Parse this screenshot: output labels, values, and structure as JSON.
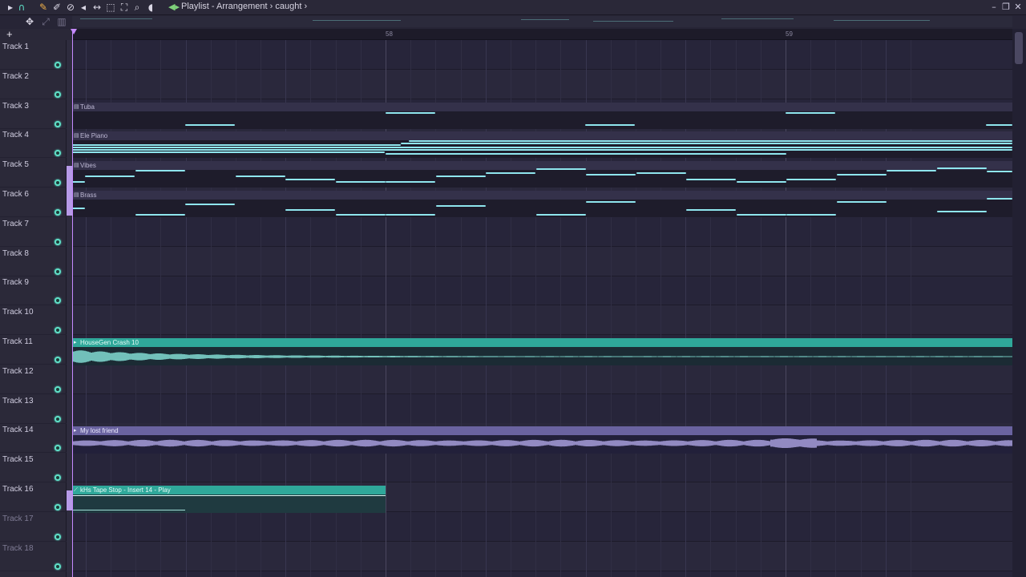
{
  "window": {
    "title": "Playlist - Arrangement",
    "crumb": "caught"
  },
  "toolbar": {
    "icons": [
      "magnet-icon",
      "pencil-icon",
      "paint-icon",
      "delete-icon",
      "mute-icon",
      "slip-icon",
      "select-icon",
      "zoom-icon",
      "magnifier-icon",
      "playback-icon"
    ]
  },
  "ruler": {
    "bars": [
      "58",
      "59"
    ]
  },
  "tracks": [
    {
      "name": "Track 1"
    },
    {
      "name": "Track 2"
    },
    {
      "name": "Track 3"
    },
    {
      "name": "Track 4"
    },
    {
      "name": "Track 5"
    },
    {
      "name": "Track 6"
    },
    {
      "name": "Track 7"
    },
    {
      "name": "Track 8"
    },
    {
      "name": "Track 9"
    },
    {
      "name": "Track 10"
    },
    {
      "name": "Track 11"
    },
    {
      "name": "Track 12"
    },
    {
      "name": "Track 13"
    },
    {
      "name": "Track 14"
    },
    {
      "name": "Track 15"
    },
    {
      "name": "Track 16"
    },
    {
      "name": "Track 17"
    },
    {
      "name": "Track 18"
    }
  ],
  "clips": {
    "tuba": "Tuba",
    "ele_piano": "Ele Piano",
    "vibes": "Vibes",
    "brass": "Brass",
    "housegen": "HouseGen Crash 10",
    "lost_friend": "My lost friend",
    "tape_stop": "kHs Tape Stop - Insert 14 - Play"
  },
  "colors": {
    "accent_teal": "#2fa89a",
    "accent_purple": "#6a63a0",
    "note": "#8fe6ee",
    "playhead": "#c58aff"
  }
}
